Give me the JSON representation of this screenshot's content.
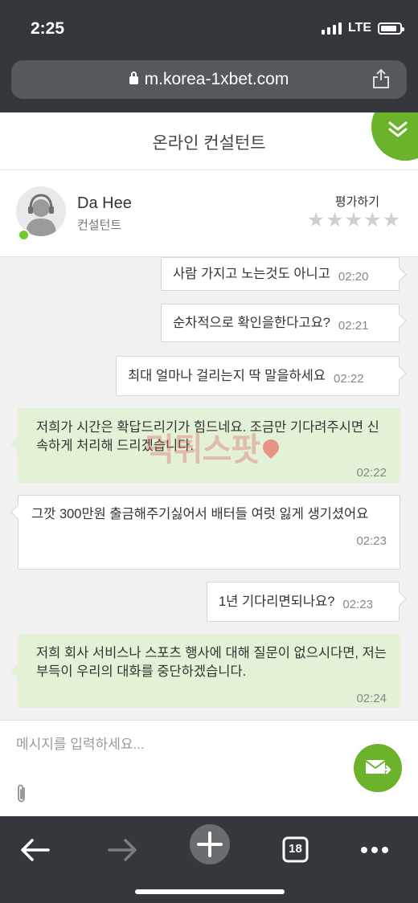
{
  "status_bar": {
    "time": "2:25",
    "network": "LTE",
    "battery_level": 0.85
  },
  "browser": {
    "url": "m.korea-1xbet.com",
    "tab_count": "18"
  },
  "chat": {
    "title": "온라인 컨설턴트",
    "agent": {
      "name": "Da Hee",
      "role": "컨설턴트",
      "rate_label": "평가하기",
      "rating": 0,
      "rating_max": 5
    },
    "messages": [
      {
        "side": "right",
        "text": "사람 가지고 노는것도 아니고",
        "time": "02:20"
      },
      {
        "side": "right",
        "text": "순차적으로 확인을한다고요?",
        "time": "02:21"
      },
      {
        "side": "right",
        "text": "최대 얼마나 걸리는지 딱 말을하세요",
        "time": "02:22"
      },
      {
        "side": "left",
        "style": "agent",
        "text": "저희가 시간은 확답드리기가 힘드네요. 조금만 기다려주시면 신속하게 처리해 드리겠습니다.",
        "time": "02:22"
      },
      {
        "side": "left",
        "style": "user",
        "text": "그깟 300만원 출금해주기싫어서 배터들 여럿 잃게 생기셨어요",
        "time": "02:23"
      },
      {
        "side": "right",
        "text": "1년 기다리면되나요?",
        "time": "02:23"
      },
      {
        "side": "left",
        "style": "agent",
        "text": "저희 회사 서비스나 스포츠 행사에 대해 질문이 없으시다면, 저는 부득이 우리의 대화를 중단하겠습니다.",
        "time": "02:24"
      }
    ],
    "input_placeholder": "메시지를 입력하세요..."
  },
  "watermark": "먹튀스팟",
  "colors": {
    "accent": "#6ab32a",
    "agent_bubble": "#e3f2d6",
    "chrome": "#34373b"
  }
}
